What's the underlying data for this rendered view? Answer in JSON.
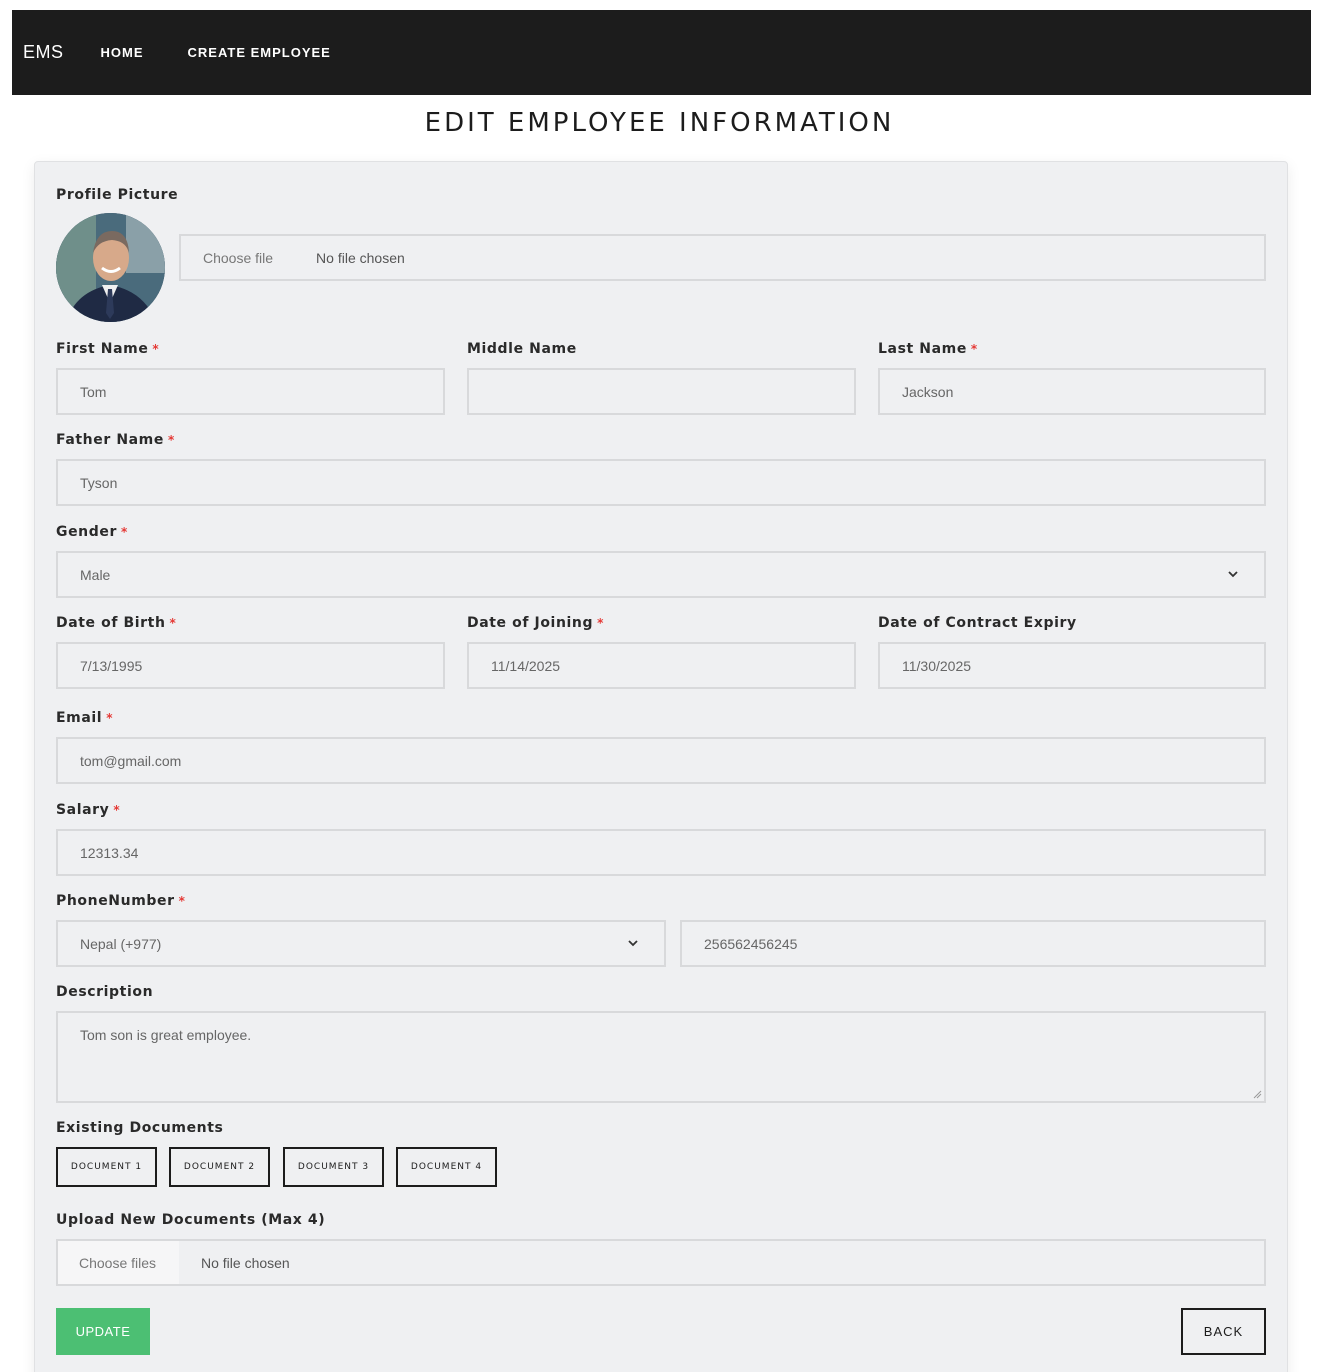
{
  "nav": {
    "brand": "EMS",
    "links": [
      "HOME",
      "CREATE EMPLOYEE"
    ]
  },
  "page_title": "EDIT EMPLOYEE INFORMATION",
  "form": {
    "profile_picture": {
      "label": "Profile Picture",
      "choose_label": "Choose file",
      "status": "No file chosen"
    },
    "first_name": {
      "label": "First Name",
      "value": "Tom",
      "required": "*"
    },
    "middle_name": {
      "label": "Middle Name",
      "value": ""
    },
    "last_name": {
      "label": "Last Name",
      "value": "Jackson",
      "required": "*"
    },
    "father_name": {
      "label": "Father Name",
      "value": "Tyson",
      "required": "*"
    },
    "gender": {
      "label": "Gender",
      "value": "Male",
      "required": "*"
    },
    "dob": {
      "label": "Date of Birth",
      "value": "7/13/1995",
      "required": "*"
    },
    "doj": {
      "label": "Date of Joining",
      "value": "11/14/2025",
      "required": "*"
    },
    "contract_expiry": {
      "label": "Date of Contract Expiry",
      "value": "11/30/2025"
    },
    "email": {
      "label": "Email",
      "value": "tom@gmail.com",
      "required": "*"
    },
    "salary": {
      "label": "Salary",
      "value": "12313.34",
      "required": "*"
    },
    "phone": {
      "label": "PhoneNumber",
      "required": "*",
      "country": "Nepal (+977)",
      "number": "256562456245"
    },
    "description": {
      "label": "Description",
      "value": "Tom son is great employee."
    },
    "existing_documents": {
      "label": "Existing Documents",
      "items": [
        "DOCUMENT 1",
        "DOCUMENT 2",
        "DOCUMENT 3",
        "DOCUMENT 4"
      ]
    },
    "upload_documents": {
      "label": "Upload New Documents (Max 4)",
      "choose_label": "Choose files",
      "status": "No file chosen"
    },
    "update_label": "UPDATE",
    "back_label": "BACK"
  },
  "colors": {
    "navbar": "#1c1c1c",
    "card": "#eff0f2",
    "update": "#4cbf73",
    "required": "#e53935"
  }
}
